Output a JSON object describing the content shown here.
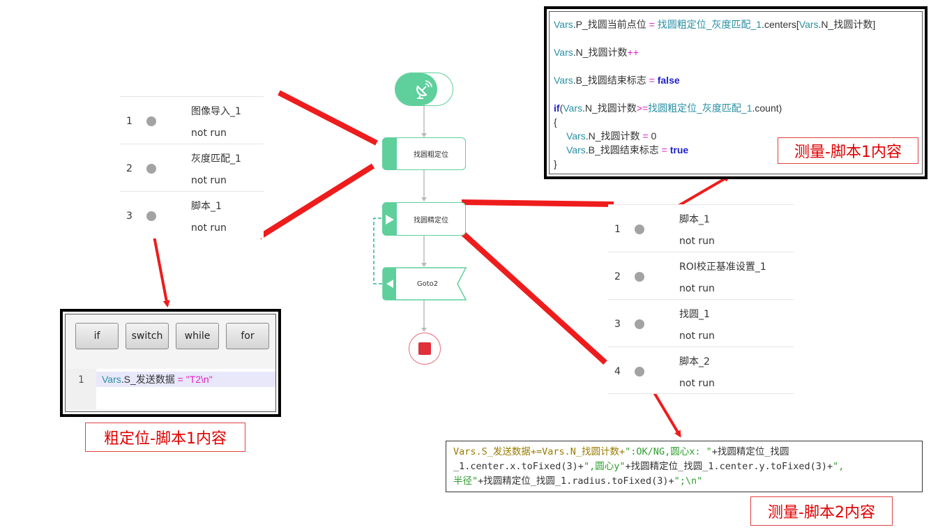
{
  "left_list": {
    "items": [
      {
        "num": "1",
        "name": "图像导入_1",
        "status": "not run"
      },
      {
        "num": "2",
        "name": "灰度匹配_1",
        "status": "not run"
      },
      {
        "num": "3",
        "name": "脚本_1",
        "status": "not run"
      }
    ]
  },
  "right_list": {
    "items": [
      {
        "num": "1",
        "name": "脚本_1",
        "status": "not run"
      },
      {
        "num": "2",
        "name": "ROI校正基准设置_1",
        "status": "not run"
      },
      {
        "num": "3",
        "name": "找圆_1",
        "status": "not run"
      },
      {
        "num": "4",
        "name": "脚本_2",
        "status": "not run"
      }
    ]
  },
  "flow": {
    "coarse_node": "找圆粗定位",
    "fine_node": "找圆精定位",
    "goto_node": "Goto2"
  },
  "script1": {
    "tokens": {
      "vars": "Vars",
      "dot": ".",
      "l1_a": "P_找圆当前点位",
      "l1_eq": " = ",
      "l1_b": "找圆粗定位_灰度匹配_1",
      "l1_c": ".centers[",
      "l1_d": "Vars",
      "l1_e": ".N_找圆计数]",
      "l2_a": "N_找圆计数",
      "l2_op": "++",
      "l3_a": "B_找圆结束标志",
      "l3_eq": " = ",
      "l3_val": "false",
      "l4_if": "if",
      "l4_paren": "(",
      "l4_a": "N_找圆计数",
      "l4_op": ">=",
      "l4_b": "找圆粗定位_灰度匹配_1",
      "l4_c": ".count)",
      "l5": "{",
      "l6_a": "N_找圆计数",
      "l6_eq": " = ",
      "l6_val": "0",
      "l7_a": "B_找圆结束标志",
      "l7_eq": " = ",
      "l7_val": "true",
      "l8": "}"
    },
    "caption": "测量-脚本1内容"
  },
  "script_coarse": {
    "buttons": [
      "if",
      "switch",
      "while",
      "for"
    ],
    "line_no": "1",
    "code_var": "Vars",
    "code_mid": ".S_发送数据",
    "code_eq": " = ",
    "code_str": "\"T2\\n\"",
    "caption": "粗定位-脚本1内容"
  },
  "script2": {
    "line1_a": "Vars.S_发送数据+=Vars.N_找圆计数+",
    "line1_b": "\":OK/NG,圆心x: \"",
    "line1_c": "+找圆精定位_找圆",
    "line2_a": "_1.center.x.toFixed(3)+",
    "line2_b": "\",圆心y\"",
    "line2_c": "+找圆精定位_找圆_1.center.y.toFixed(3)+",
    "line2_d": "\",",
    "line3_a": "半径\"",
    "line3_b": "+找圆精定位_找圆_1.radius.toFixed(3)+",
    "line3_c": "\";\\n\"",
    "caption": "测量-脚本2内容"
  },
  "colors": {
    "flow_green": "#5fcf9c",
    "arrow_red": "#ee1c1c",
    "caption_red": "#e00000",
    "var_teal": "#2a8fa3",
    "op_magenta": "#e020c0",
    "kw_blue": "#2020d0",
    "code_olive": "#9a7b00",
    "code_green": "#2e9e2e"
  },
  "icons": {
    "start": "satellite-dish-icon",
    "end": "stop-square-icon",
    "play": "play-triangle-icon"
  }
}
